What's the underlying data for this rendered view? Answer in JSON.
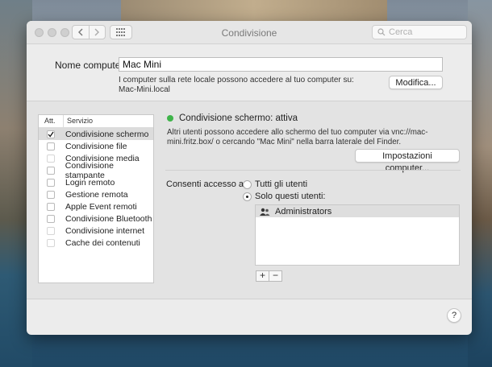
{
  "window": {
    "title": "Condivisione"
  },
  "toolbar": {
    "search_placeholder": "Cerca"
  },
  "computer_name": {
    "label": "Nome computer:",
    "value": "Mac Mini",
    "description_line1": "I computer sulla rete locale possono accedere al tuo computer su:",
    "description_line2": "Mac-Mini.local",
    "edit_button": "Modifica..."
  },
  "services": {
    "header_on": "Att.",
    "header_service": "Servizio",
    "items": [
      {
        "label": "Condivisione schermo",
        "checked": true,
        "selected": true
      },
      {
        "label": "Condivisione file",
        "checked": false
      },
      {
        "label": "Condivisione media",
        "checked": false
      },
      {
        "label": "Condivisione stampante",
        "checked": false
      },
      {
        "label": "Login remoto",
        "checked": false
      },
      {
        "label": "Gestione remota",
        "checked": false
      },
      {
        "label": "Apple Event remoti",
        "checked": false
      },
      {
        "label": "Condivisione Bluetooth",
        "checked": false
      },
      {
        "label": "Condivisione internet",
        "checked": false
      },
      {
        "label": "Cache dei contenuti",
        "checked": false
      }
    ]
  },
  "detail": {
    "status": "Condivisione schermo: attiva",
    "status_color": "#3fb44a",
    "desc_prefix": "Altri utenti possono accedere allo schermo del tuo computer via ",
    "desc_address": "vnc://mac-mini.fritz.box/",
    "desc_suffix": " o cercando \"Mac Mini\" nella barra laterale del Finder.",
    "settings_button": "Impostazioni computer...",
    "access_label": "Consenti accesso a:",
    "radio_all": "Tutti gli utenti",
    "radio_only": "Solo questi utenti:",
    "users": [
      "Administrators"
    ],
    "add_label": "+",
    "remove_label": "−"
  },
  "help_label": "?"
}
